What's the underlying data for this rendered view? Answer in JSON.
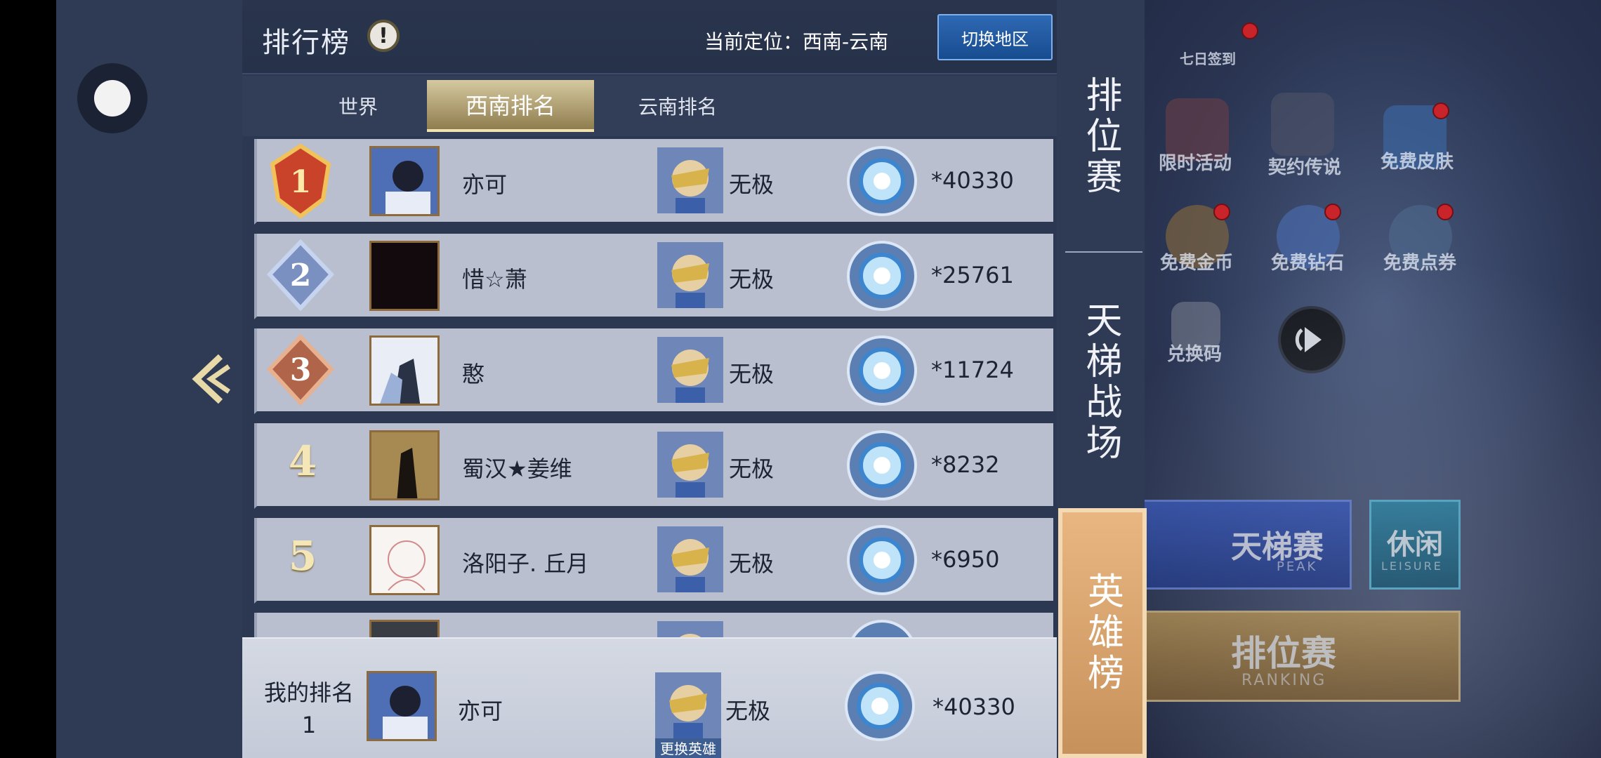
{
  "header": {
    "title": "排行榜",
    "info_glyph": "!",
    "location": "当前定位：西南-云南",
    "switch_button": "切换地区"
  },
  "tabs": [
    {
      "label": "世界",
      "active": false
    },
    {
      "label": "西南排名",
      "active": true
    },
    {
      "label": "云南排名",
      "active": false
    }
  ],
  "rows": [
    {
      "rank": "1",
      "name": "亦可",
      "hero": "无极",
      "score": "*40330"
    },
    {
      "rank": "2",
      "name": "惜☆萧",
      "hero": "无极",
      "score": "*25761"
    },
    {
      "rank": "3",
      "name": "憨",
      "hero": "无极",
      "score": "*11724"
    },
    {
      "rank": "4",
      "name": "蜀汉★姜维",
      "hero": "无极",
      "score": "*8232"
    },
    {
      "rank": "5",
      "name": "洛阳子. 丘月",
      "hero": "无极",
      "score": "*6950"
    }
  ],
  "my_rank": {
    "label": "我的排名",
    "rank": "1",
    "name": "亦可",
    "hero": "无极",
    "change_hero": "更换英雄",
    "score": "*40330"
  },
  "side_tabs": [
    {
      "label": "排位赛",
      "active": false
    },
    {
      "label": "天梯战场",
      "active": false
    },
    {
      "label": "英雄榜",
      "active": true
    }
  ],
  "background": {
    "checkin": "七日签到",
    "limited_event": "限时活动",
    "contract": "契约传说",
    "free_skin": "免费皮肤",
    "free_gold": "免费金币",
    "free_diamond": "免费钻石",
    "free_coupon": "免费点券",
    "redeem": "兑换码",
    "ladder_cn": "天梯赛",
    "ladder_en": "PEAK",
    "leisure_cn": "休闲",
    "leisure_en": "LEISURE",
    "ranking_cn": "排位赛",
    "ranking_en": "RANKING"
  },
  "colors": {
    "panel": "#2c3852",
    "row": "#b9bfcf",
    "active_tab": "#d6c9a0",
    "switch_button": "#2f69b4",
    "side_active": "#e9b681"
  }
}
